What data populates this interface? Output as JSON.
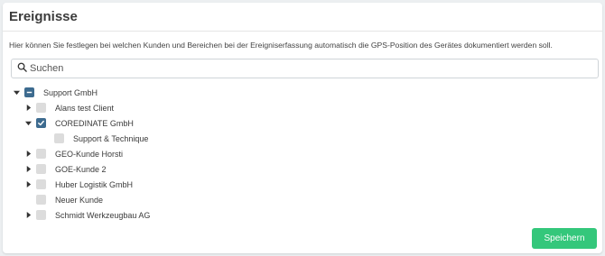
{
  "header": {
    "title": "Ereignisse"
  },
  "description": "Hier können Sie festlegen bei welchen Kunden und Bereichen bei der Ereigniserfassung automatisch die GPS-Position des Gerätes dokumentiert werden soll.",
  "search": {
    "placeholder": "Suchen",
    "icon": "search-icon"
  },
  "tree": {
    "root": {
      "label": "Support GmbH",
      "state": "partial",
      "expanded": true
    },
    "children": [
      {
        "label": "Alans test Client",
        "state": "unchecked",
        "expandable": true,
        "expanded": false
      },
      {
        "label": "COREDINATE GmbH",
        "state": "checked",
        "expandable": true,
        "expanded": true,
        "children": [
          {
            "label": "Support & Technique",
            "state": "unchecked"
          }
        ]
      },
      {
        "label": "GEO-Kunde Horsti",
        "state": "unchecked",
        "expandable": true,
        "expanded": false
      },
      {
        "label": "GOE-Kunde 2",
        "state": "unchecked",
        "expandable": true,
        "expanded": false
      },
      {
        "label": "Huber Logistik GmbH",
        "state": "unchecked",
        "expandable": true,
        "expanded": false
      },
      {
        "label": "Neuer Kunde",
        "state": "unchecked",
        "expandable": false
      },
      {
        "label": "Schmidt Werkzeugbau AG",
        "state": "unchecked",
        "expandable": true,
        "expanded": false
      }
    ]
  },
  "footer": {
    "save_label": "Speichern"
  },
  "colors": {
    "accent": "#3d6b8f",
    "save": "#34c77b",
    "checkbox_off": "#dcdcdc"
  }
}
